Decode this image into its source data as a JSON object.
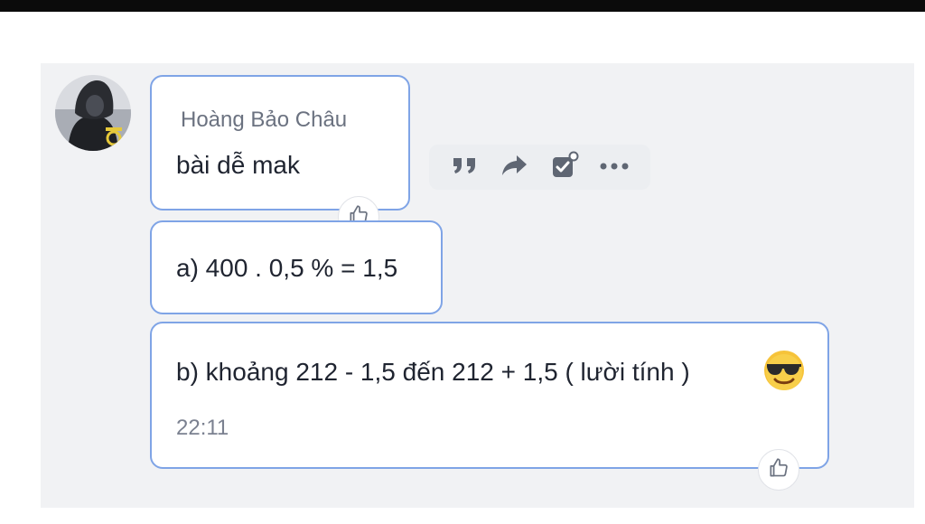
{
  "message_group": {
    "sender_name": "Hoàng Bảo Châu",
    "messages": [
      {
        "text": "bài dễ mak"
      },
      {
        "text": "a) 400 . 0,5 % = 1,5"
      },
      {
        "text": "b) khoảng 212 - 1,5 đến 212 + 1,5 ( lười tính )",
        "emoji": "smiling-face-with-sunglasses",
        "time": "22:11"
      }
    ]
  },
  "hover_actions": [
    "quote-icon",
    "forward-icon",
    "task-icon",
    "more-icon"
  ],
  "colors": {
    "bubble_border": "#7fa4e6",
    "chat_background": "#f1f2f4",
    "text": "#1f2430",
    "muted": "#6b7280"
  }
}
